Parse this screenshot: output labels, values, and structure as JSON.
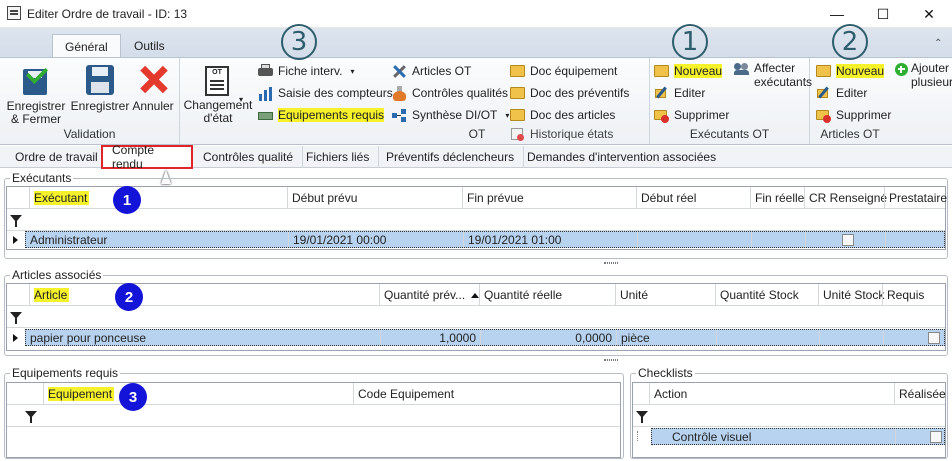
{
  "window": {
    "title": "Editer Ordre de travail - ID: 13",
    "minimize": "—",
    "maximize": "☐",
    "close": "✕"
  },
  "ribbon_tabs": [
    "Général",
    "Outils"
  ],
  "ribbon": {
    "validation": {
      "save_close": "Enregistrer\n& Fermer",
      "save": "Enregistrer",
      "cancel": "Annuler",
      "label": "Validation"
    },
    "ot": {
      "change_state": "Changement\nd'état",
      "fiche": "Fiche interv.",
      "saisie": "Saisie des compteurs",
      "equipements": "Equipements requis",
      "articles_ot": "Articles OT",
      "controles": "Contrôles qualités",
      "synthese": "Synthèse DI/OT",
      "doc_equip": "Doc équipement",
      "doc_prev": "Doc des préventifs",
      "doc_art": "Doc des articles",
      "historique": "Historique états",
      "label": "OT",
      "callout": "3"
    },
    "executants": {
      "nouveau": "Nouveau",
      "editer": "Editer",
      "supprimer": "Supprimer",
      "affecter": "Affecter\nexécutants",
      "label": "Exécutants OT",
      "callout": "1"
    },
    "articles": {
      "nouveau": "Nouveau",
      "editer": "Editer",
      "supprimer": "Supprimer",
      "ajouter": "Ajouter\nplusieurs",
      "label": "Articles OT",
      "callout": "2"
    }
  },
  "form_tabs": [
    "Ordre de travail",
    "Compte rendu",
    "Contrôles qualité",
    "Fichiers liés",
    "Préventifs déclencheurs",
    "Demandes d'intervention associées"
  ],
  "executants": {
    "title": "Exécutants",
    "callout": "1",
    "columns": [
      "Exécutant",
      "Début prévu",
      "Fin prévue",
      "Début réel",
      "Fin réelle",
      "CR Renseigné",
      "Prestataire"
    ],
    "rows": [
      {
        "executant": "Administrateur",
        "debut": "19/01/2021 00:00",
        "fin": "19/01/2021 01:00",
        "cr": false
      }
    ]
  },
  "articles": {
    "title": "Articles associés",
    "callout": "2",
    "columns": [
      "Article",
      "Quantité prév...",
      "Quantité réelle",
      "Unité",
      "Quantité Stock",
      "Unité Stock",
      "Requis"
    ],
    "rows": [
      {
        "article": "papier pour ponceuse",
        "qte_prev": "1,0000",
        "qte_reelle": "0,0000",
        "unite": "pièce",
        "requis": false
      }
    ]
  },
  "equipements": {
    "title": "Equipements requis",
    "callout": "3",
    "columns": [
      "Equipement",
      "Code Equipement"
    ]
  },
  "checklists": {
    "title": "Checklists",
    "columns": [
      "Action",
      "Réalisée"
    ],
    "rows": [
      {
        "action": "Contrôle visuel",
        "done": false
      }
    ]
  },
  "colors": {
    "highlight": "#f5f12a",
    "selected_row": "#b8d3f0",
    "callout_blue": "#1414d8",
    "callout_ring": "#2e5e6e",
    "tab_border": "#e0252a"
  }
}
